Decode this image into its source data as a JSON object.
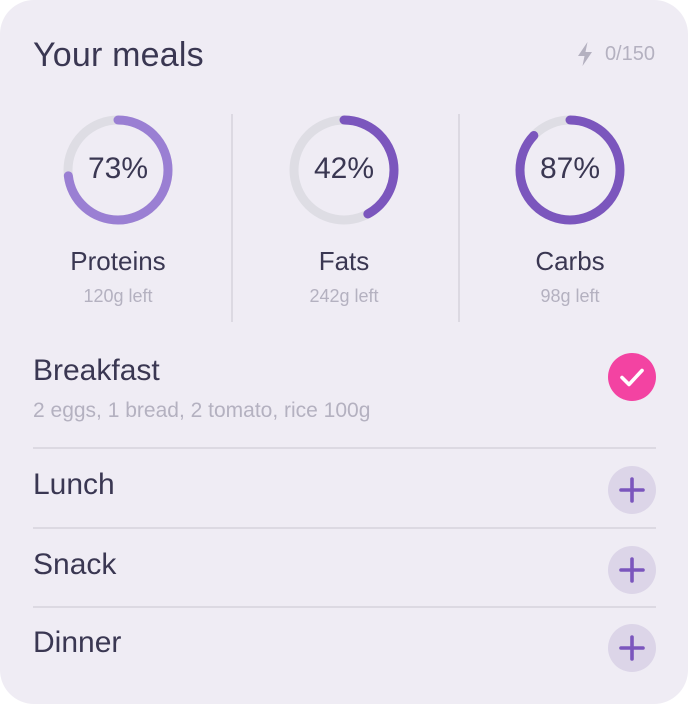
{
  "header": {
    "title": "Your meals",
    "energy_icon": "lightning-icon",
    "energy_count": "0/150"
  },
  "macros": [
    {
      "label": "Proteins",
      "percent_text": "73%",
      "progress": 0.73,
      "left": "120g left",
      "color": "#9a7fd3"
    },
    {
      "label": "Fats",
      "percent_text": "42%",
      "progress": 0.42,
      "left": "242g left",
      "color": "#7b56bd"
    },
    {
      "label": "Carbs",
      "percent_text": "87%",
      "progress": 0.87,
      "left": "98g left",
      "color": "#7b56bd"
    }
  ],
  "meals": [
    {
      "name": "Breakfast",
      "description": "2 eggs, 1 bread, 2 tomato, rice 100g",
      "status": "done",
      "icon": "check-icon"
    },
    {
      "name": "Lunch",
      "status": "add",
      "icon": "plus-icon"
    },
    {
      "name": "Snack",
      "status": "add",
      "icon": "plus-icon"
    },
    {
      "name": "Dinner",
      "status": "add",
      "icon": "plus-icon"
    }
  ],
  "colors": {
    "card_background": "#efecf4",
    "ring_track": "#dedde4",
    "accent_purple": "#7b56bd",
    "done_pink": "#f343a2",
    "add_button_bg": "#dcd5e8"
  }
}
